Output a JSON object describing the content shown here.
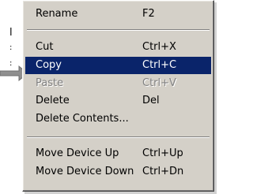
{
  "background": {
    "fragments": [
      "l",
      ":",
      ":"
    ]
  },
  "context_menu": {
    "items": [
      {
        "label": "Rename",
        "shortcut": "F2",
        "state": "normal"
      },
      {
        "label": "Cut",
        "shortcut": "Ctrl+X",
        "state": "normal"
      },
      {
        "label": "Copy",
        "shortcut": "Ctrl+C",
        "state": "selected"
      },
      {
        "label": "Paste",
        "shortcut": "Ctrl+V",
        "state": "disabled"
      },
      {
        "label": "Delete",
        "shortcut": "Del",
        "state": "normal"
      },
      {
        "label": "Delete Contents...",
        "shortcut": "",
        "state": "normal"
      },
      {
        "label": "Move Device Up",
        "shortcut": "Ctrl+Up",
        "state": "normal"
      },
      {
        "label": "Move Device Down",
        "shortcut": "Ctrl+Dn",
        "state": "normal"
      }
    ]
  },
  "colors": {
    "menu_face": "#d4d0c8",
    "highlight": "#0a246a",
    "highlight_text": "#ffffff",
    "disabled_text": "#808080",
    "pointer_arrow": "#8f8f8f"
  },
  "icons": {
    "pointer": "pointer-arrow-icon"
  }
}
